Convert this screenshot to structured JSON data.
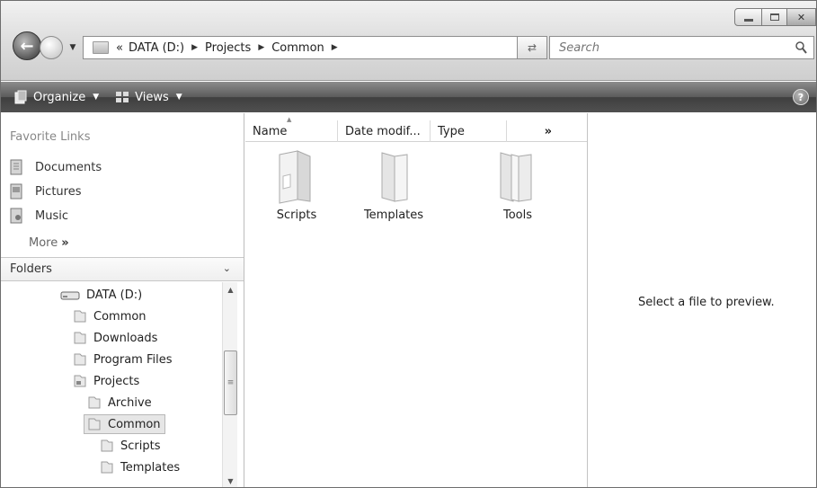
{
  "window": {
    "caption_buttons": {
      "minimize_icon": "minimize-icon",
      "maximize_icon": "maximize-icon",
      "close_icon": "close-icon"
    }
  },
  "address": {
    "overflow": "«",
    "breadcrumbs": [
      "DATA (D:)",
      "Projects",
      "Common"
    ]
  },
  "search": {
    "placeholder": "Search"
  },
  "toolbar": {
    "organize_label": "Organize",
    "views_label": "Views",
    "help": "?"
  },
  "nav": {
    "favorites_title": "Favorite Links",
    "favorites": [
      "Documents",
      "Pictures",
      "Music"
    ],
    "more_label": "More",
    "more_chevron": "»",
    "folders_title": "Folders",
    "tree": [
      {
        "label": "DATA (D:)",
        "icon": "drive-icon"
      },
      {
        "label": "Common",
        "icon": "folder-icon"
      },
      {
        "label": "Downloads",
        "icon": "folder-icon"
      },
      {
        "label": "Program Files",
        "icon": "folder-icon"
      },
      {
        "label": "Projects",
        "icon": "project-folder-icon"
      },
      {
        "label": "Archive",
        "icon": "folder-icon"
      },
      {
        "label": "Common",
        "icon": "folder-icon",
        "selected": true
      },
      {
        "label": "Scripts",
        "icon": "folder-icon"
      },
      {
        "label": "Templates",
        "icon": "folder-icon"
      }
    ]
  },
  "files": {
    "columns": [
      "Name",
      "Date modif...",
      "Type"
    ],
    "more_columns": "»",
    "items": [
      "Scripts",
      "Templates",
      "Tools"
    ]
  },
  "preview": {
    "message": "Select a file to preview."
  }
}
